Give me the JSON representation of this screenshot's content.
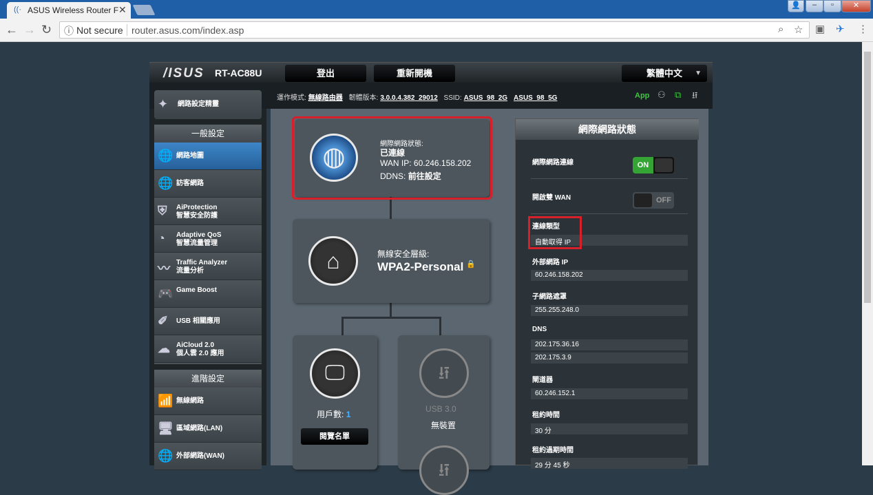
{
  "browser": {
    "tab_title": "ASUS Wireless Router F",
    "omnibox_security": "Not secure",
    "omnibox_url": "router.asus.com/index.asp"
  },
  "header": {
    "logo": "/ISUS",
    "model": "RT-AC88U",
    "logout": "登出",
    "reboot": "重新開機",
    "language": "繁體中文"
  },
  "infobar": {
    "mode_label": "運作模式:",
    "mode_value": "無線路由器",
    "firmware_label": "韌體版本:",
    "firmware_value": "3.0.0.4.382_29012",
    "ssid_label": "SSID:",
    "ssid_2g": "ASUS_98_2G",
    "ssid_5g": "ASUS_98_5G",
    "app": "App"
  },
  "sidebar": {
    "quick_setup": "網路設定精靈",
    "general_title": "一般設定",
    "general_items": [
      {
        "label": "網路地圖",
        "label2": ""
      },
      {
        "label": "訪客網路",
        "label2": ""
      },
      {
        "label": "AiProtection",
        "label2": "智慧安全防護"
      },
      {
        "label": "Adaptive QoS",
        "label2": "智慧流量管理"
      },
      {
        "label": "Traffic Analyzer",
        "label2": "流量分析"
      },
      {
        "label": "Game Boost",
        "label2": ""
      },
      {
        "label": "USB 相關應用",
        "label2": ""
      },
      {
        "label": "AiCloud 2.0",
        "label2": "個人雲 2.0 應用"
      }
    ],
    "advanced_title": "進階設定",
    "advanced_items": [
      {
        "label": "無線網路"
      },
      {
        "label": "區域網路(LAN)"
      },
      {
        "label": "外部網路(WAN)"
      }
    ]
  },
  "network_map": {
    "internet_status_label": "網際網路狀態:",
    "internet_status_value": "已連線",
    "wan_ip": "WAN IP: 60.246.158.202",
    "ddns": "DDNS:",
    "ddns_link": "前往設定",
    "security_label": "無線安全層級:",
    "security_value": "WPA2-Personal",
    "clients_label": "用戶數:",
    "clients_count": "1",
    "view_list": "閱覽名單",
    "usb_label": "USB 3.0",
    "usb_status": "無裝置"
  },
  "status_panel": {
    "title": "網際網路狀態",
    "internet_connection_label": "網際網路連線",
    "internet_connection_on": "ON",
    "dual_wan_label": "開啟雙 WAN",
    "dual_wan_off": "OFF",
    "connection_type_label": "連線類型",
    "connection_type_value": "自動取得 IP",
    "wan_ip_label": "外部網路 IP",
    "wan_ip_value": "60.246.158.202",
    "subnet_label": "子網路遮罩",
    "subnet_value": "255.255.248.0",
    "dns_label": "DNS",
    "dns_values": [
      "202.175.36.16",
      "202.175.3.9"
    ],
    "gateway_label": "閘道器",
    "gateway_value": "60.246.152.1",
    "lease_label": "租約時間",
    "lease_value": "30 分",
    "lease_remaining_label": "租約過期時間",
    "lease_remaining_value": "29 分 45 秒"
  },
  "colors": {
    "accent_green": "#34a534",
    "highlight_red": "#d8202a",
    "active_blue": "#3d86c8"
  }
}
